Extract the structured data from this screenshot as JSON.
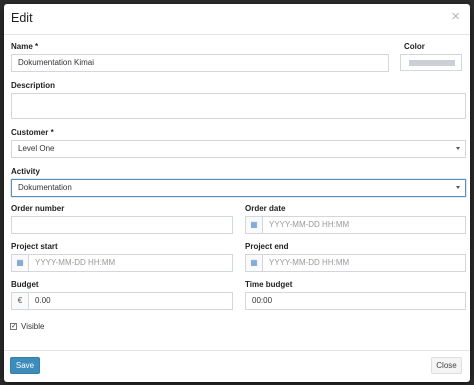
{
  "modal": {
    "title": "Edit",
    "close_glyph": "×"
  },
  "form": {
    "name": {
      "label": "Name *",
      "value": "Dokumentation Kimai"
    },
    "color": {
      "label": "Color",
      "value_color": "#ccd0d6"
    },
    "description": {
      "label": "Description",
      "value": ""
    },
    "customer": {
      "label": "Customer *",
      "value": "Level One"
    },
    "activity": {
      "label": "Activity",
      "value": "Dokumentation"
    },
    "order_number": {
      "label": "Order number",
      "value": ""
    },
    "order_date": {
      "label": "Order date",
      "placeholder": "YYYY-MM-DD HH:MM",
      "icon": "calendar-icon"
    },
    "project_start": {
      "label": "Project start",
      "placeholder": "YYYY-MM-DD HH:MM",
      "icon": "calendar-icon"
    },
    "project_end": {
      "label": "Project end",
      "placeholder": "YYYY-MM-DD HH:MM",
      "icon": "calendar-icon"
    },
    "budget": {
      "label": "Budget",
      "currency": "€",
      "value": "0.00"
    },
    "time_budget": {
      "label": "Time budget",
      "value": "00:00"
    },
    "visible": {
      "label": "Visible",
      "checked": true,
      "check_glyph": "✓"
    }
  },
  "footer": {
    "save_label": "Save",
    "close_label": "Close"
  },
  "colors": {
    "primary": "#3c8dbc",
    "focus_border": "#5b8fc9"
  }
}
